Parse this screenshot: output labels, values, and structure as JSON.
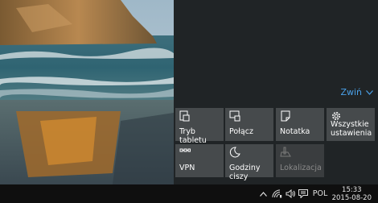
{
  "action_center": {
    "collapse_label": "Zwiń",
    "tiles": [
      {
        "label": "Tryb tabletu",
        "icon": "tablet-mode-icon",
        "enabled": true
      },
      {
        "label": "Połącz",
        "icon": "connect-icon",
        "enabled": true
      },
      {
        "label": "Notatka",
        "icon": "note-icon",
        "enabled": true
      },
      {
        "label": "Wszystkie ustawienia",
        "icon": "settings-gear-icon",
        "enabled": true
      },
      {
        "label": "VPN",
        "icon": "vpn-icon",
        "enabled": true
      },
      {
        "label": "Godziny ciszy",
        "icon": "moon-icon",
        "enabled": true
      },
      {
        "label": "Lokalizacja",
        "icon": "location-icon",
        "enabled": false
      }
    ]
  },
  "taskbar": {
    "language": "POL",
    "time": "15:33",
    "date": "2015-08-20"
  },
  "colors": {
    "accent": "#4aa0e8",
    "panel": "#202426",
    "tile": "#464a4c",
    "taskbar": "#0f0f0f"
  }
}
